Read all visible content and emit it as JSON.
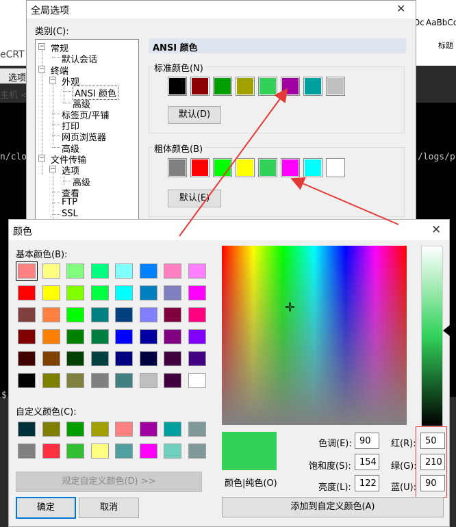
{
  "background_app": {
    "word_preview": "AaBbCc",
    "word_preview_partial": "Dc",
    "word_style": "标题",
    "app_name_fragment": "eCRT",
    "menu_item": "选项",
    "host_fragment": "主机 <A",
    "term_left": "n/clo",
    "term_right": "/logs/pr",
    "term_prompt": "$"
  },
  "options_dialog": {
    "title": "全局选项",
    "category_label": "类别(C):",
    "tree": [
      {
        "label": "常规",
        "depth": 0,
        "expander": "−"
      },
      {
        "label": "默认会话",
        "depth": 1
      },
      {
        "label": "终端",
        "depth": 0,
        "expander": "−"
      },
      {
        "label": "外观",
        "depth": 1,
        "expander": "−"
      },
      {
        "label": "ANSI 颜色",
        "depth": 2,
        "selected": true
      },
      {
        "label": "高级",
        "depth": 2
      },
      {
        "label": "标签页/平铺",
        "depth": 1
      },
      {
        "label": "打印",
        "depth": 1
      },
      {
        "label": "网页浏览器",
        "depth": 1
      },
      {
        "label": "高级",
        "depth": 1
      },
      {
        "label": "文件传输",
        "depth": 0,
        "expander": "−"
      },
      {
        "label": "选项",
        "depth": 1,
        "expander": "−"
      },
      {
        "label": "高级",
        "depth": 2
      },
      {
        "label": "查看",
        "depth": 1
      },
      {
        "label": "FTP",
        "depth": 1
      },
      {
        "label": "SSL",
        "depth": 1
      }
    ],
    "panel_title": "ANSI 颜色",
    "normal_colors_label": "标准颜色(N)",
    "normal_colors": [
      "#000000",
      "#8b0000",
      "#009e00",
      "#a0a000",
      "#32d25a",
      "#a000a0",
      "#00a0a0",
      "#c0c0c0"
    ],
    "normal_default_button": "默认(D)",
    "bold_colors_label": "粗体颜色(B)",
    "bold_colors": [
      "#808080",
      "#ff0000",
      "#00ff00",
      "#ffff00",
      "#32d25a",
      "#ff00ff",
      "#00ffff",
      "#ffffff"
    ],
    "bold_default_button": "默认(E)"
  },
  "color_dialog": {
    "title": "颜色",
    "basic_colors_label": "基本颜色(B):",
    "basic_colors": [
      [
        "#ff8080",
        "#ffff80",
        "#80ff80",
        "#00ff80",
        "#80ffff",
        "#0080ff",
        "#ff80c0",
        "#ff80ff"
      ],
      [
        "#ff0000",
        "#ffff00",
        "#80ff00",
        "#00ff40",
        "#00ffff",
        "#0080c0",
        "#8080c0",
        "#ff00ff"
      ],
      [
        "#804040",
        "#ff8040",
        "#00ff00",
        "#008080",
        "#004080",
        "#8080ff",
        "#800040",
        "#ff0080"
      ],
      [
        "#800000",
        "#ff8000",
        "#008000",
        "#008040",
        "#0000ff",
        "#0000a0",
        "#800080",
        "#8000ff"
      ],
      [
        "#400000",
        "#804000",
        "#004000",
        "#004040",
        "#000080",
        "#000040",
        "#400040",
        "#400080"
      ],
      [
        "#000000",
        "#808000",
        "#808040",
        "#808080",
        "#408080",
        "#c0c0c0",
        "#400040",
        "#ffffff"
      ]
    ],
    "custom_colors_label": "自定义颜色(C):",
    "custom_colors": [
      [
        "#00303a",
        "#808000",
        "#009e00",
        "#a0a000",
        "#ff8080",
        "#a000a0",
        "#00a0a0",
        "#7f9999"
      ],
      [
        "#808080",
        "#ff3040",
        "#32c032",
        "#ffff80",
        "#50a0a0",
        "#ff00ff",
        "#70d0c0",
        "#7f9999"
      ]
    ],
    "define_custom_button": "规定自定义颜色(D) >>",
    "ok_button": "确定",
    "cancel_button": "取消",
    "preview_label": "颜色|纯色(O)",
    "selected_color": "#32d25a",
    "hue_label": "色调(E):",
    "hue": "90",
    "sat_label": "饱和度(S):",
    "sat": "154",
    "lum_label": "亮度(L):",
    "lum": "122",
    "red_label": "红(R):",
    "red": "50",
    "green_label": "绿(G):",
    "green": "210",
    "blue_label": "蓝(U):",
    "blue": "90",
    "add_custom_button": "添加到自定义颜色(A)",
    "highlight_color": "#e53935"
  }
}
